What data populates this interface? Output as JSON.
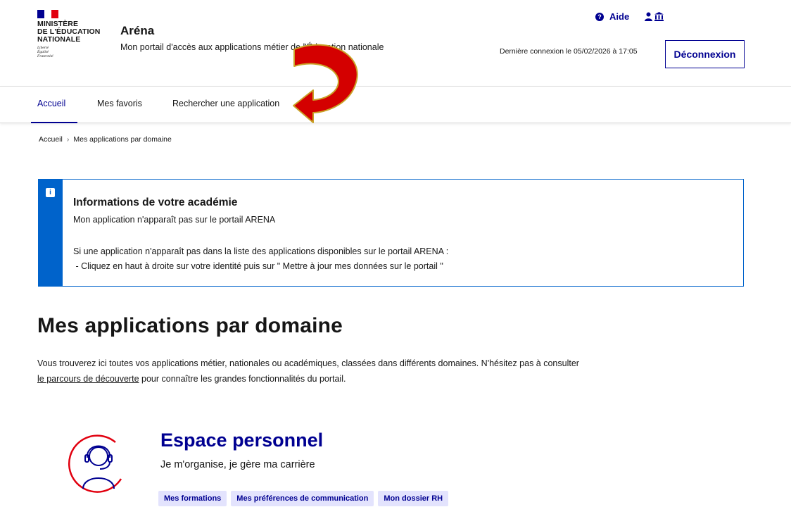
{
  "colors": {
    "brand_blue": "#000091",
    "info_blue": "#0063cb",
    "flag_red": "#e1000f",
    "arrow_red": "#d40000",
    "arrow_gold": "#c9a227",
    "tag_bg": "#e3e3fd"
  },
  "header": {
    "logo_lines": [
      "MINISTÈRE",
      "DE L'ÉDUCATION",
      "NATIONALE"
    ],
    "motto_lines": [
      "Liberté",
      "Égalité",
      "Fraternité"
    ],
    "service_title": "Aréna",
    "tagline": "Mon portail d'accès aux applications métier de l'Éducation nationale",
    "help_label": "Aide",
    "help_icon": "question-circle-icon",
    "user_icon": "user-icon",
    "institution_icon": "institution-icon",
    "last_login": "Dernière connexion le 05/02/2026 à 17:05",
    "logout_label": "Déconnexion"
  },
  "nav": {
    "items": [
      {
        "label": "Accueil",
        "active": true
      },
      {
        "label": "Mes favoris",
        "active": false
      },
      {
        "label": "Rechercher une application",
        "active": false
      }
    ]
  },
  "breadcrumb": {
    "home": "Accueil",
    "separator": "›",
    "current": "Mes applications par domaine"
  },
  "callout": {
    "icon": "info-icon",
    "title": "Informations de votre académie",
    "line1": "Mon application n'apparaît pas sur le portail ARENA",
    "line2": "Si une application n'apparaît pas dans la liste des applications disponibles sur le portail ARENA :",
    "line3": " - Cliquez en haut à droite sur votre identité puis sur \" Mettre à jour mes données sur le portail \""
  },
  "main": {
    "title": "Mes applications par domaine",
    "intro_text": "Vous trouverez ici toutes vos applications métier, nationales ou académiques, classées dans différents domaines. N'hésitez pas à consulter",
    "intro_link": "le parcours de découverte",
    "intro_end": " pour connaître les grandes fonctionnalités du portail."
  },
  "domain": {
    "icon": "person-headset-icon",
    "title": "Espace personnel",
    "subtitle": "Je m'organise, je gère ma carrière",
    "tags": [
      "Mes formations",
      "Mes préférences de communication",
      "Mon dossier RH"
    ]
  }
}
